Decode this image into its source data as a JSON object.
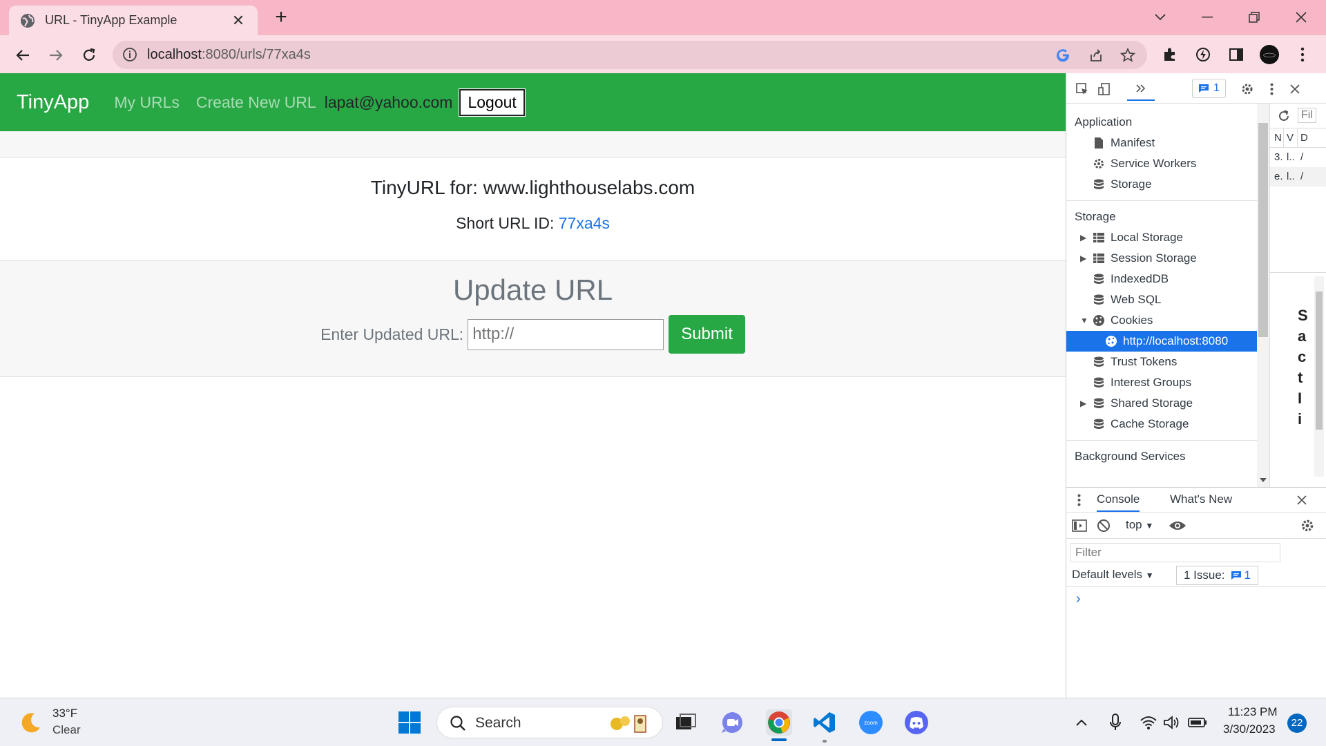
{
  "browser": {
    "tab_title": "URL - TinyApp Example",
    "tab_close": "✕",
    "new_tab": "+",
    "url_host": "localhost",
    "url_rest": ":8080/urls/77xa4s"
  },
  "page": {
    "brand": "TinyApp",
    "nav_links": [
      "My URLs",
      "Create New URL"
    ],
    "user_email": "lapat@yahoo.com",
    "logout_label": "Logout",
    "tinyurl_heading": "TinyURL for: www.lighthouselabs.com",
    "short_id_label": "Short URL ID:",
    "short_id": "77xa4s",
    "update_heading": "Update URL",
    "update_label": "Enter Updated URL:",
    "update_placeholder": "http://",
    "submit_label": "Submit",
    "accent_color": "#28a745"
  },
  "devtools": {
    "issues_count": "1",
    "application_section": "Application",
    "application_items": [
      "Manifest",
      "Service Workers",
      "Storage"
    ],
    "storage_section": "Storage",
    "storage_items": {
      "local_storage": "Local Storage",
      "session_storage": "Session Storage",
      "indexeddb": "IndexedDB",
      "web_sql": "Web SQL",
      "cookies": "Cookies",
      "cookie_origin": "http://localhost:8080",
      "trust_tokens": "Trust Tokens",
      "interest_groups": "Interest Groups",
      "shared_storage": "Shared Storage",
      "cache_storage": "Cache Storage"
    },
    "background_section": "Background Services",
    "right_filter": "Fil",
    "right_headers": [
      "N",
      "V",
      "D"
    ],
    "right_rows": [
      [
        "3.",
        "l..",
        "/"
      ],
      [
        "e.",
        "l..",
        "/"
      ]
    ],
    "right_partial_text": [
      "S",
      "a",
      "c",
      "t",
      "I",
      "i"
    ],
    "drawer_tabs": [
      "Console",
      "What's New"
    ],
    "context": "top",
    "filter_placeholder": "Filter",
    "default_levels": "Default levels",
    "issues_label": "1 Issue:",
    "issues_label_count": "1",
    "prompt": "›"
  },
  "taskbar": {
    "weather_temp": "33°F",
    "weather_desc": "Clear",
    "search_label": "Search",
    "time": "11:23 PM",
    "date": "3/30/2023",
    "notification_count": "22"
  }
}
